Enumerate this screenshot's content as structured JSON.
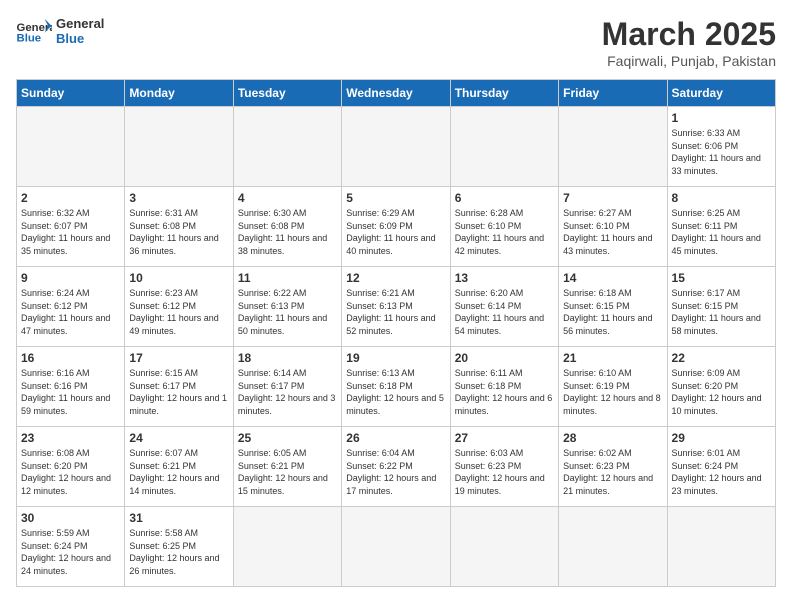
{
  "header": {
    "logo_general": "General",
    "logo_blue": "Blue",
    "month_year": "March 2025",
    "location": "Faqirwali, Punjab, Pakistan"
  },
  "days_of_week": [
    "Sunday",
    "Monday",
    "Tuesday",
    "Wednesday",
    "Thursday",
    "Friday",
    "Saturday"
  ],
  "weeks": [
    [
      {
        "day": "",
        "empty": true
      },
      {
        "day": "",
        "empty": true
      },
      {
        "day": "",
        "empty": true
      },
      {
        "day": "",
        "empty": true
      },
      {
        "day": "",
        "empty": true
      },
      {
        "day": "",
        "empty": true
      },
      {
        "day": "1",
        "sunrise": "6:33 AM",
        "sunset": "6:06 PM",
        "daylight": "11 hours and 33 minutes."
      }
    ],
    [
      {
        "day": "2",
        "sunrise": "6:32 AM",
        "sunset": "6:07 PM",
        "daylight": "11 hours and 35 minutes."
      },
      {
        "day": "3",
        "sunrise": "6:31 AM",
        "sunset": "6:08 PM",
        "daylight": "11 hours and 36 minutes."
      },
      {
        "day": "4",
        "sunrise": "6:30 AM",
        "sunset": "6:08 PM",
        "daylight": "11 hours and 38 minutes."
      },
      {
        "day": "5",
        "sunrise": "6:29 AM",
        "sunset": "6:09 PM",
        "daylight": "11 hours and 40 minutes."
      },
      {
        "day": "6",
        "sunrise": "6:28 AM",
        "sunset": "6:10 PM",
        "daylight": "11 hours and 42 minutes."
      },
      {
        "day": "7",
        "sunrise": "6:27 AM",
        "sunset": "6:10 PM",
        "daylight": "11 hours and 43 minutes."
      },
      {
        "day": "8",
        "sunrise": "6:25 AM",
        "sunset": "6:11 PM",
        "daylight": "11 hours and 45 minutes."
      }
    ],
    [
      {
        "day": "9",
        "sunrise": "6:24 AM",
        "sunset": "6:12 PM",
        "daylight": "11 hours and 47 minutes."
      },
      {
        "day": "10",
        "sunrise": "6:23 AM",
        "sunset": "6:12 PM",
        "daylight": "11 hours and 49 minutes."
      },
      {
        "day": "11",
        "sunrise": "6:22 AM",
        "sunset": "6:13 PM",
        "daylight": "11 hours and 50 minutes."
      },
      {
        "day": "12",
        "sunrise": "6:21 AM",
        "sunset": "6:13 PM",
        "daylight": "11 hours and 52 minutes."
      },
      {
        "day": "13",
        "sunrise": "6:20 AM",
        "sunset": "6:14 PM",
        "daylight": "11 hours and 54 minutes."
      },
      {
        "day": "14",
        "sunrise": "6:18 AM",
        "sunset": "6:15 PM",
        "daylight": "11 hours and 56 minutes."
      },
      {
        "day": "15",
        "sunrise": "6:17 AM",
        "sunset": "6:15 PM",
        "daylight": "11 hours and 58 minutes."
      }
    ],
    [
      {
        "day": "16",
        "sunrise": "6:16 AM",
        "sunset": "6:16 PM",
        "daylight": "11 hours and 59 minutes."
      },
      {
        "day": "17",
        "sunrise": "6:15 AM",
        "sunset": "6:17 PM",
        "daylight": "12 hours and 1 minute."
      },
      {
        "day": "18",
        "sunrise": "6:14 AM",
        "sunset": "6:17 PM",
        "daylight": "12 hours and 3 minutes."
      },
      {
        "day": "19",
        "sunrise": "6:13 AM",
        "sunset": "6:18 PM",
        "daylight": "12 hours and 5 minutes."
      },
      {
        "day": "20",
        "sunrise": "6:11 AM",
        "sunset": "6:18 PM",
        "daylight": "12 hours and 6 minutes."
      },
      {
        "day": "21",
        "sunrise": "6:10 AM",
        "sunset": "6:19 PM",
        "daylight": "12 hours and 8 minutes."
      },
      {
        "day": "22",
        "sunrise": "6:09 AM",
        "sunset": "6:20 PM",
        "daylight": "12 hours and 10 minutes."
      }
    ],
    [
      {
        "day": "23",
        "sunrise": "6:08 AM",
        "sunset": "6:20 PM",
        "daylight": "12 hours and 12 minutes."
      },
      {
        "day": "24",
        "sunrise": "6:07 AM",
        "sunset": "6:21 PM",
        "daylight": "12 hours and 14 minutes."
      },
      {
        "day": "25",
        "sunrise": "6:05 AM",
        "sunset": "6:21 PM",
        "daylight": "12 hours and 15 minutes."
      },
      {
        "day": "26",
        "sunrise": "6:04 AM",
        "sunset": "6:22 PM",
        "daylight": "12 hours and 17 minutes."
      },
      {
        "day": "27",
        "sunrise": "6:03 AM",
        "sunset": "6:23 PM",
        "daylight": "12 hours and 19 minutes."
      },
      {
        "day": "28",
        "sunrise": "6:02 AM",
        "sunset": "6:23 PM",
        "daylight": "12 hours and 21 minutes."
      },
      {
        "day": "29",
        "sunrise": "6:01 AM",
        "sunset": "6:24 PM",
        "daylight": "12 hours and 23 minutes."
      }
    ],
    [
      {
        "day": "30",
        "sunrise": "5:59 AM",
        "sunset": "6:24 PM",
        "daylight": "12 hours and 24 minutes."
      },
      {
        "day": "31",
        "sunrise": "5:58 AM",
        "sunset": "6:25 PM",
        "daylight": "12 hours and 26 minutes."
      },
      {
        "day": "",
        "empty": true
      },
      {
        "day": "",
        "empty": true
      },
      {
        "day": "",
        "empty": true
      },
      {
        "day": "",
        "empty": true
      },
      {
        "day": "",
        "empty": true
      }
    ]
  ]
}
